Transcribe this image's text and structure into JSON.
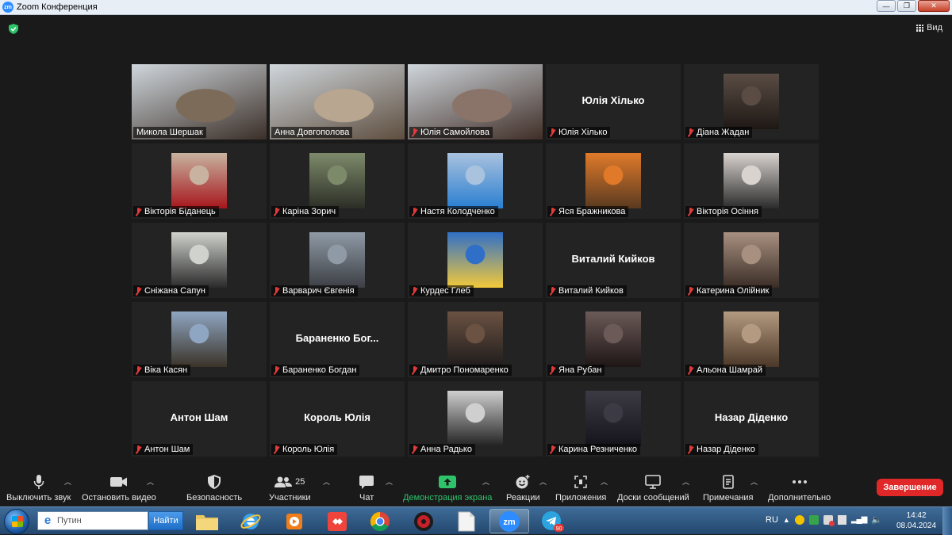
{
  "window": {
    "title": "Zoom Конференция"
  },
  "header": {
    "view_label": "Вид"
  },
  "participants": [
    {
      "name": "Микола Шершак",
      "display": "video",
      "muted": false,
      "active": true
    },
    {
      "name": "Анна Довгополова",
      "display": "video",
      "muted": false
    },
    {
      "name": "Юлія Самойлова",
      "display": "video",
      "muted": true
    },
    {
      "name": "Юлія Хілько",
      "display": "text",
      "muted": true
    },
    {
      "name": "Діана Жадан",
      "display": "photo",
      "muted": true
    },
    {
      "name": "Вікторія Біданець",
      "display": "photo",
      "muted": true
    },
    {
      "name": "Каріна Зорич",
      "display": "photo",
      "muted": true
    },
    {
      "name": "Настя Колодченко",
      "display": "photo",
      "muted": true
    },
    {
      "name": "Яся Бражникова",
      "display": "photo",
      "muted": true
    },
    {
      "name": "Вікторія Осіння",
      "display": "photo",
      "muted": true
    },
    {
      "name": "Сніжана Сапун",
      "display": "photo",
      "muted": true
    },
    {
      "name": "Варварич Євгенія",
      "display": "photo",
      "muted": true
    },
    {
      "name": "Курдес Глеб",
      "display": "photo",
      "muted": true
    },
    {
      "name": "Виталий Кийков",
      "display": "text",
      "muted": true
    },
    {
      "name": "Катерина Олійник",
      "display": "photo",
      "muted": true
    },
    {
      "name": "Віка Касян",
      "display": "photo",
      "muted": true
    },
    {
      "name": "Бараненко Богдан",
      "display": "text",
      "center_text": "Бараненко  Бог...",
      "muted": true
    },
    {
      "name": "Дмитро Пономаренко",
      "display": "photo",
      "muted": true
    },
    {
      "name": "Яна Рубан",
      "display": "photo",
      "muted": true
    },
    {
      "name": "Альона Шамрай",
      "display": "photo",
      "muted": true
    },
    {
      "name": "Антон Шам",
      "display": "text",
      "muted": true
    },
    {
      "name": "Король Юлія",
      "display": "text",
      "muted": true
    },
    {
      "name": "Анна Радько",
      "display": "photo",
      "muted": true
    },
    {
      "name": "Карина Резниченко",
      "display": "photo",
      "muted": true
    },
    {
      "name": "Назар Діденко",
      "display": "text",
      "muted": true
    }
  ],
  "toolbar": {
    "mute": "Выключить звук",
    "video": "Остановить видео",
    "security": "Безопасность",
    "participants": "Участники",
    "participants_count": "25",
    "chat": "Чат",
    "share": "Демонстрация экрана",
    "reactions": "Реакции",
    "apps": "Приложения",
    "whiteboards": "Доски сообщений",
    "notes": "Примечания",
    "more": "Дополнительно",
    "end": "Завершение"
  },
  "taskbar": {
    "search_value": "Путин",
    "search_button": "Найти",
    "language": "RU",
    "time": "14:42",
    "date": "08.04.2024",
    "telegram_badge": "90"
  }
}
